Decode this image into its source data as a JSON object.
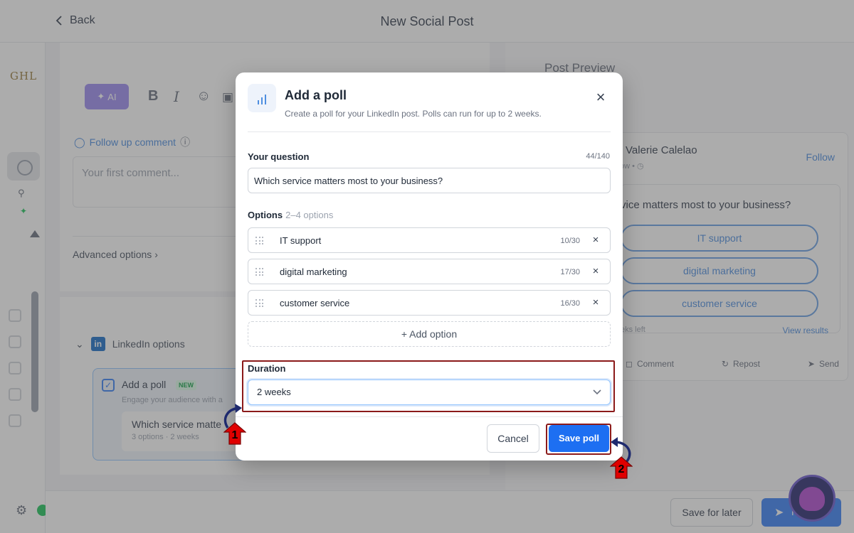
{
  "header": {
    "back_label": "Back",
    "title": "New Social Post"
  },
  "sidebar": {
    "brand": "GHL"
  },
  "editor": {
    "ai_label": "AI",
    "follow_up_label": "Follow up comment",
    "comment_placeholder": "Your first comment...",
    "advanced_label": "Advanced options"
  },
  "linkedin": {
    "section_label": "LinkedIn options",
    "badge_text": "in",
    "poll_card": {
      "title": "Add a poll",
      "badge": "NEW",
      "description": "Engage your audience with a",
      "question": "Which service matte",
      "meta": "3 options · 2 weeks"
    }
  },
  "preview": {
    "title": "Post Preview",
    "author": "Valerie Calelao",
    "meta": "ow • ◷",
    "follow_label": "Follow",
    "question": "vice matters most to your business?",
    "options": [
      "IT support",
      "digital marketing",
      "customer service"
    ],
    "time_left": "eks left",
    "view_results": "View results",
    "actions": [
      "Comment",
      "Repost",
      "Send"
    ]
  },
  "footer": {
    "save_later_label": "Save for later",
    "publish_label": "P"
  },
  "modal": {
    "title": "Add a poll",
    "subtitle": "Create a poll for your LinkedIn post. Polls can run for up to 2 weeks.",
    "question_label": "Your question",
    "question_count": "44/140",
    "question_value": "Which service matters most to your business?",
    "options_label": "Options",
    "options_hint": "2–4 options",
    "options": [
      {
        "text": "IT support",
        "count": "10/30"
      },
      {
        "text": "digital marketing",
        "count": "17/30"
      },
      {
        "text": "customer service",
        "count": "16/30"
      }
    ],
    "add_option_label": "+ Add option",
    "duration_label": "Duration",
    "duration_value": "2 weeks",
    "cancel_label": "Cancel",
    "save_label": "Save poll"
  },
  "annotations": {
    "step1": "1",
    "step2": "2",
    "highlight_color": "#8b1a1a",
    "badge_color": "#e00000"
  },
  "colors": {
    "primary": "#1d6ff2",
    "accent_link": "#4f8fe0",
    "ai_purple": "#9d8cf0"
  }
}
